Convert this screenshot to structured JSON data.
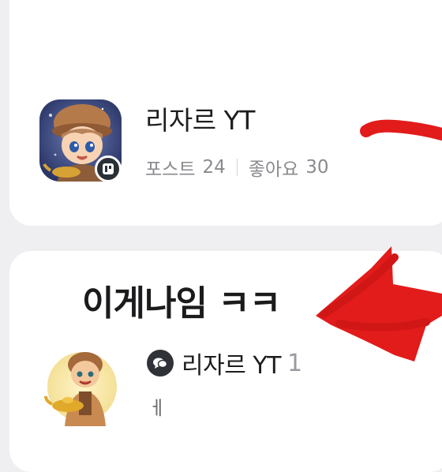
{
  "blog_card": {
    "name": "리자르 YT",
    "stats": {
      "posts_label": "포스트",
      "posts_count": "24",
      "likes_label": "좋아요",
      "likes_count": "30"
    },
    "avatar_icon": "avatar-genie-boy-icon",
    "badge_icon": "blog-badge-icon"
  },
  "post_card": {
    "title": "이게나임 ㅋㅋ",
    "author": "리자르 YT",
    "comment_count": "1",
    "comment_text": "ㅔ",
    "avatar_icon": "avatar-genie-lamp-icon",
    "comment_icon": "comment-bubble-icon"
  },
  "overlay": {
    "scribble_color": "#e21b1b",
    "drawings": [
      "red-line-scribble",
      "red-arrow-scribble"
    ]
  }
}
